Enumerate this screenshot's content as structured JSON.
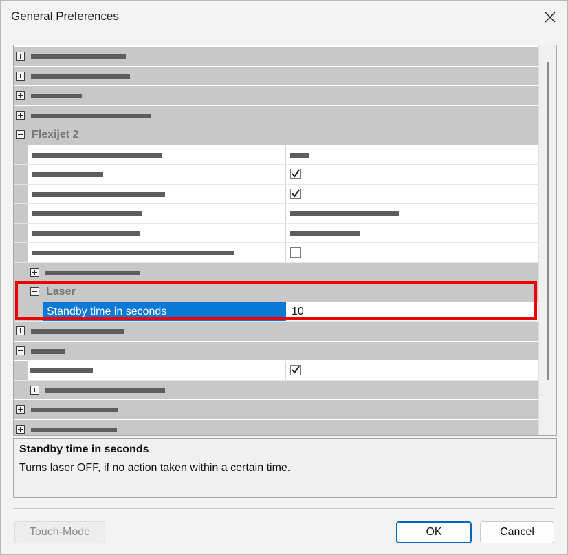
{
  "window": {
    "title": "General Preferences"
  },
  "grid": {
    "categories": {
      "flexijet": "Flexijet 2",
      "laser": "Laser"
    },
    "selected_property": {
      "name": "Standby time in seconds",
      "value": "10"
    }
  },
  "help": {
    "title": "Standby time in seconds",
    "description": "Turns laser OFF, if no action taken within a certain time."
  },
  "buttons": {
    "touch_mode": "Touch-Mode",
    "ok": "OK",
    "cancel": "Cancel"
  },
  "colors": {
    "selection": "#0a78d7",
    "highlight": "#ee0000",
    "category_bg": "#c8c8c8"
  }
}
